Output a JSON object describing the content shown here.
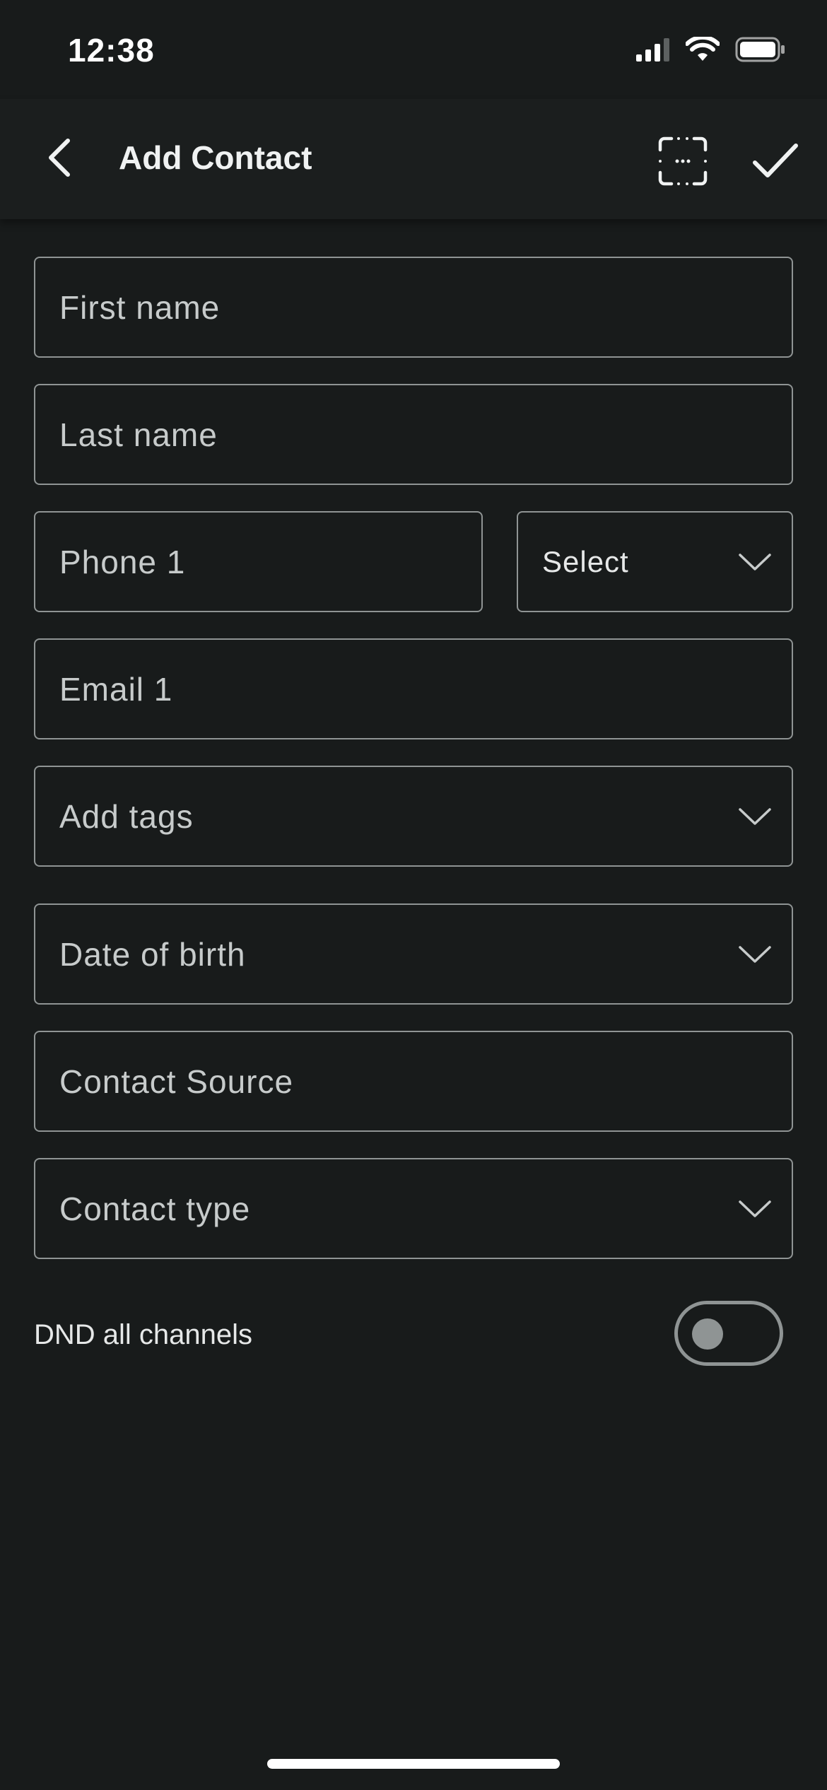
{
  "status_bar": {
    "time": "12:38",
    "icons": [
      "signal-icon",
      "wifi-icon",
      "battery-icon"
    ]
  },
  "header": {
    "title": "Add Contact",
    "back_icon": "chevron-left-icon",
    "scan_icon": "scan-icon",
    "save_icon": "checkmark-icon"
  },
  "form": {
    "first_name": {
      "placeholder": "First name",
      "value": ""
    },
    "last_name": {
      "placeholder": "Last name",
      "value": ""
    },
    "phone_1": {
      "placeholder": "Phone 1",
      "value": ""
    },
    "phone_type": {
      "selected": "Select",
      "icon": "chevron-down-icon"
    },
    "email_1": {
      "placeholder": "Email 1",
      "value": ""
    },
    "tags": {
      "label": "Add tags",
      "icon": "chevron-down-icon"
    },
    "date_of_birth": {
      "label": "Date of birth",
      "icon": "chevron-down-icon"
    },
    "contact_source": {
      "placeholder": "Contact Source",
      "value": ""
    },
    "contact_type": {
      "label": "Contact type",
      "icon": "chevron-down-icon"
    }
  },
  "dnd": {
    "label": "DND all channels",
    "enabled": false
  },
  "colors": {
    "background": "#181b1b",
    "header": "#1b1e1e",
    "border": "#8f9494",
    "text": "#e6e8e8",
    "placeholder": "#c7cbcb"
  }
}
